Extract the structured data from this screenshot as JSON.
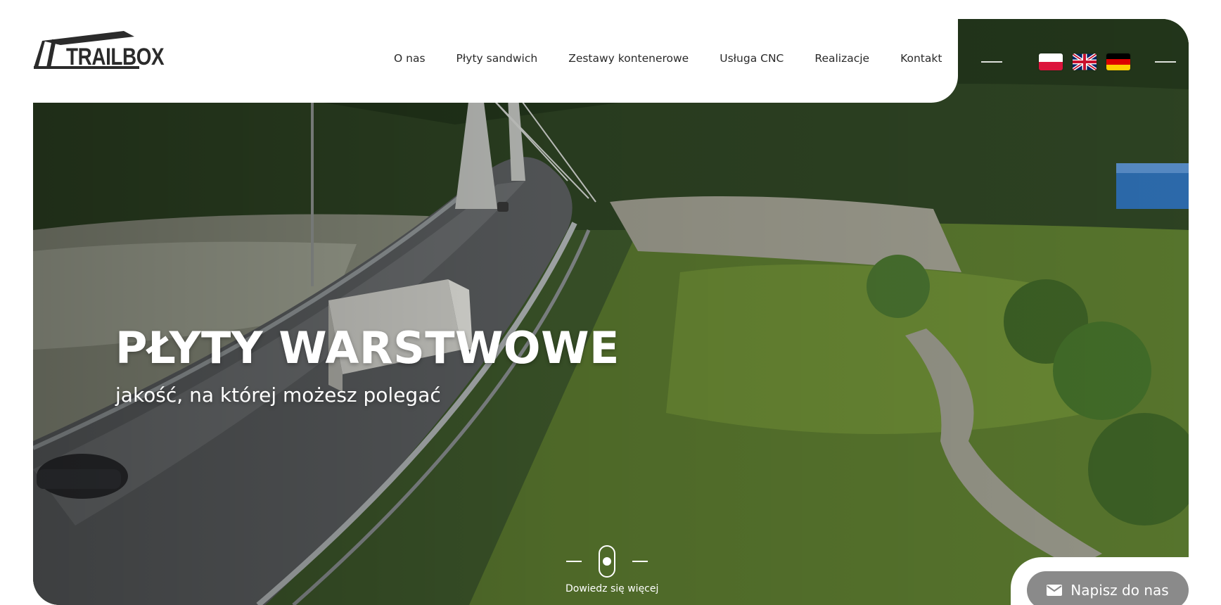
{
  "brand": {
    "logo_text": "TRAILBOX"
  },
  "nav": {
    "items": [
      {
        "label": "O nas"
      },
      {
        "label": "Płyty sandwich"
      },
      {
        "label": "Zestawy kontenerowe"
      },
      {
        "label": "Usługa CNC"
      },
      {
        "label": "Realizacje"
      },
      {
        "label": "Kontakt"
      }
    ]
  },
  "languages": [
    {
      "code": "pl",
      "icon": "flag-pl-icon"
    },
    {
      "code": "en",
      "icon": "flag-gb-icon"
    },
    {
      "code": "de",
      "icon": "flag-de-icon"
    }
  ],
  "hero": {
    "title": "PŁYTY WARSTWOWE",
    "subtitle": "jakość, na której możesz polegać"
  },
  "scroll": {
    "label": "Dowiedz się więcej",
    "icon": "mouse-scroll-icon"
  },
  "contact": {
    "label": "Napisz do nas",
    "icon": "mail-icon"
  },
  "colors": {
    "header_bg": "#ffffff",
    "contact_button": "#8a8a8a",
    "text_dark": "#2a2a2a"
  }
}
